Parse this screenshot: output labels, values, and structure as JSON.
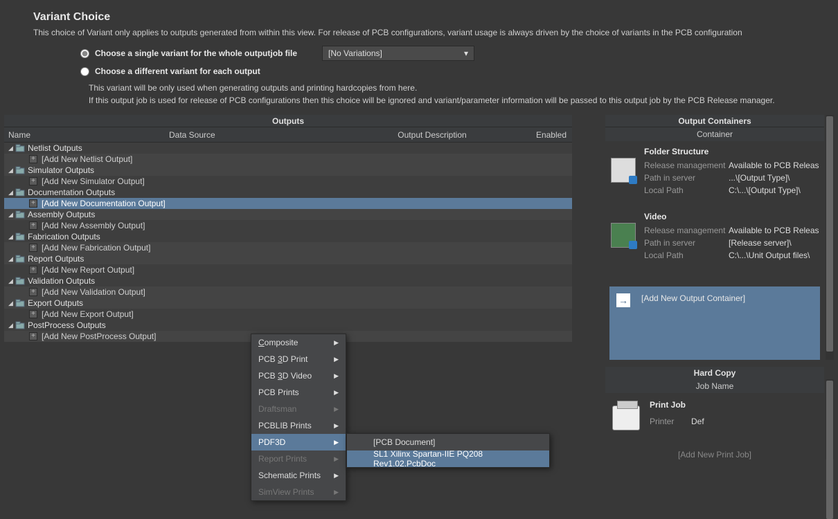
{
  "variant": {
    "title": "Variant Choice",
    "description": "This choice of Variant only applies to outputs generated from within this view. For release of PCB configurations, variant usage is always driven by the choice of variants in the PCB configuration",
    "radio_single": "Choose a single variant for the whole outputjob file",
    "radio_each": "Choose a different variant for each output",
    "dropdown_value": "[No Variations]",
    "note1": "This variant will be only used when generating outputs and printing hardcopies from here.",
    "note2": "If this output job is used for release of PCB configurations then this choice will be ignored and variant/parameter information will be passed to this output job by the PCB Release manager."
  },
  "outputs": {
    "header": "Outputs",
    "columns": {
      "name": "Name",
      "data_source": "Data Source",
      "description": "Output Description",
      "enabled": "Enabled"
    },
    "groups": [
      {
        "label": "Netlist Outputs",
        "add": "[Add New Netlist Output]"
      },
      {
        "label": "Simulator Outputs",
        "add": "[Add New Simulator Output]"
      },
      {
        "label": "Documentation Outputs",
        "add": "[Add New Documentation Output]",
        "selected": true
      },
      {
        "label": "Assembly Outputs",
        "add": "[Add New Assembly Output]"
      },
      {
        "label": "Fabrication Outputs",
        "add": "[Add New Fabrication Output]"
      },
      {
        "label": "Report Outputs",
        "add": "[Add New Report Output]"
      },
      {
        "label": "Validation Outputs",
        "add": "[Add New Validation Output]"
      },
      {
        "label": "Export Outputs",
        "add": "[Add New Export Output]"
      },
      {
        "label": "PostProcess Outputs",
        "add": "[Add New PostProcess Output]"
      }
    ]
  },
  "context_menu": {
    "items": [
      {
        "label": "Composite",
        "enabled": true,
        "submenu": true,
        "u": 0
      },
      {
        "label": "PCB 3D Print",
        "enabled": true,
        "submenu": true,
        "u": 4
      },
      {
        "label": "PCB 3D Video",
        "enabled": true,
        "submenu": true,
        "u": 4
      },
      {
        "label": "PCB Prints",
        "enabled": true,
        "submenu": true
      },
      {
        "label": "Draftsman",
        "enabled": false,
        "submenu": true
      },
      {
        "label": "PCBLIB Prints",
        "enabled": true,
        "submenu": true
      },
      {
        "label": "PDF3D",
        "enabled": true,
        "submenu": true,
        "highlight": true
      },
      {
        "label": "Report Prints",
        "enabled": false,
        "submenu": true
      },
      {
        "label": "Schematic Prints",
        "enabled": true,
        "submenu": true
      },
      {
        "label": "SimView Prints",
        "enabled": false,
        "submenu": true
      }
    ]
  },
  "sub_menu": {
    "items": [
      {
        "label": "[PCB Document]"
      },
      {
        "label": "SL1 Xilinx Spartan-IIE PQ208 Rev1.02.PcbDoc",
        "highlight": true
      }
    ]
  },
  "containers": {
    "header": "Output Containers",
    "col": "Container",
    "blocks": [
      {
        "title": "Folder Structure",
        "rows": [
          {
            "label": "Release management",
            "value": "Available to PCB Releas"
          },
          {
            "label": "Path in server",
            "value": "...\\[Output Type]\\"
          },
          {
            "label": "Local Path",
            "value": "C:\\...\\[Output Type]\\"
          }
        ]
      },
      {
        "title": "Video",
        "rows": [
          {
            "label": "Release management",
            "value": "Available to PCB Releas"
          },
          {
            "label": "Path in server",
            "value": "[Release server]\\"
          },
          {
            "label": "Local Path",
            "value": "C:\\...\\Unit Output files\\"
          }
        ]
      }
    ],
    "add_label": "[Add New Output Container]"
  },
  "hardcopy": {
    "header": "Hard Copy",
    "col": "Job Name",
    "title": "Print Job",
    "printer_label": "Printer",
    "printer_value": "Def",
    "add_label": "[Add New Print Job]"
  }
}
